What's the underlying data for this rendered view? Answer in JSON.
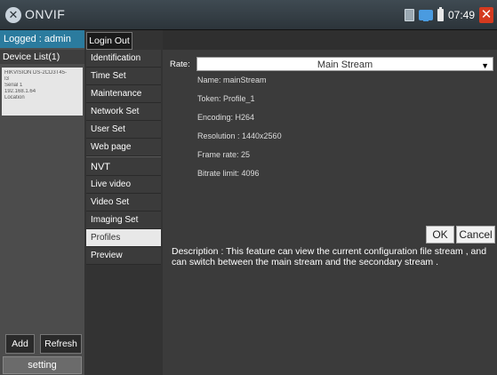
{
  "titlebar": {
    "app_title": "ONVIF",
    "logo_glyph": "✕",
    "time": "07:49",
    "close_glyph": "✕",
    "status_icons": [
      "calculator-icon",
      "network-icon",
      "battery-icon"
    ]
  },
  "left": {
    "logged_in": "Logged : admin",
    "device_list_header": "Device List(1)",
    "device": {
      "model": "HIKVISION DS-2CD3T45-",
      "model_suffix": "I3",
      "serial": "Serial 1",
      "ip": "192.168.1.64",
      "location": "Location"
    },
    "add_label": "Add",
    "refresh_label": "Refresh",
    "setting_label": "setting"
  },
  "nav": {
    "logout_label": "Login Out",
    "items_top": [
      "Identification",
      "Time Set",
      "Maintenance",
      "Network Set",
      "User Set",
      "Web page"
    ],
    "section_label": "NVT",
    "items_bottom": [
      "Live video",
      "Video Set",
      "Imaging Set",
      "Profiles",
      "Preview"
    ],
    "selected": "Profiles"
  },
  "main": {
    "rate_label": "Rate:",
    "stream_select": "Main Stream",
    "fields": {
      "name": "Name:  mainStream",
      "token": "Token:  Profile_1",
      "encoding": "Encoding:  H264",
      "resolution": "Resolution :   1440x2560",
      "frame_rate": "Frame rate:  25",
      "bitrate": "Bitrate limit:  4096"
    },
    "ok_label": "OK",
    "cancel_label": "Cancel",
    "description": "Description : This feature can view the current configuration file stream , and can switch between the main stream and the secondary stream ."
  },
  "colors": {
    "accent": "#2b7b9e",
    "close": "#d43a1f",
    "selected_nav": "#e8e8e8"
  }
}
